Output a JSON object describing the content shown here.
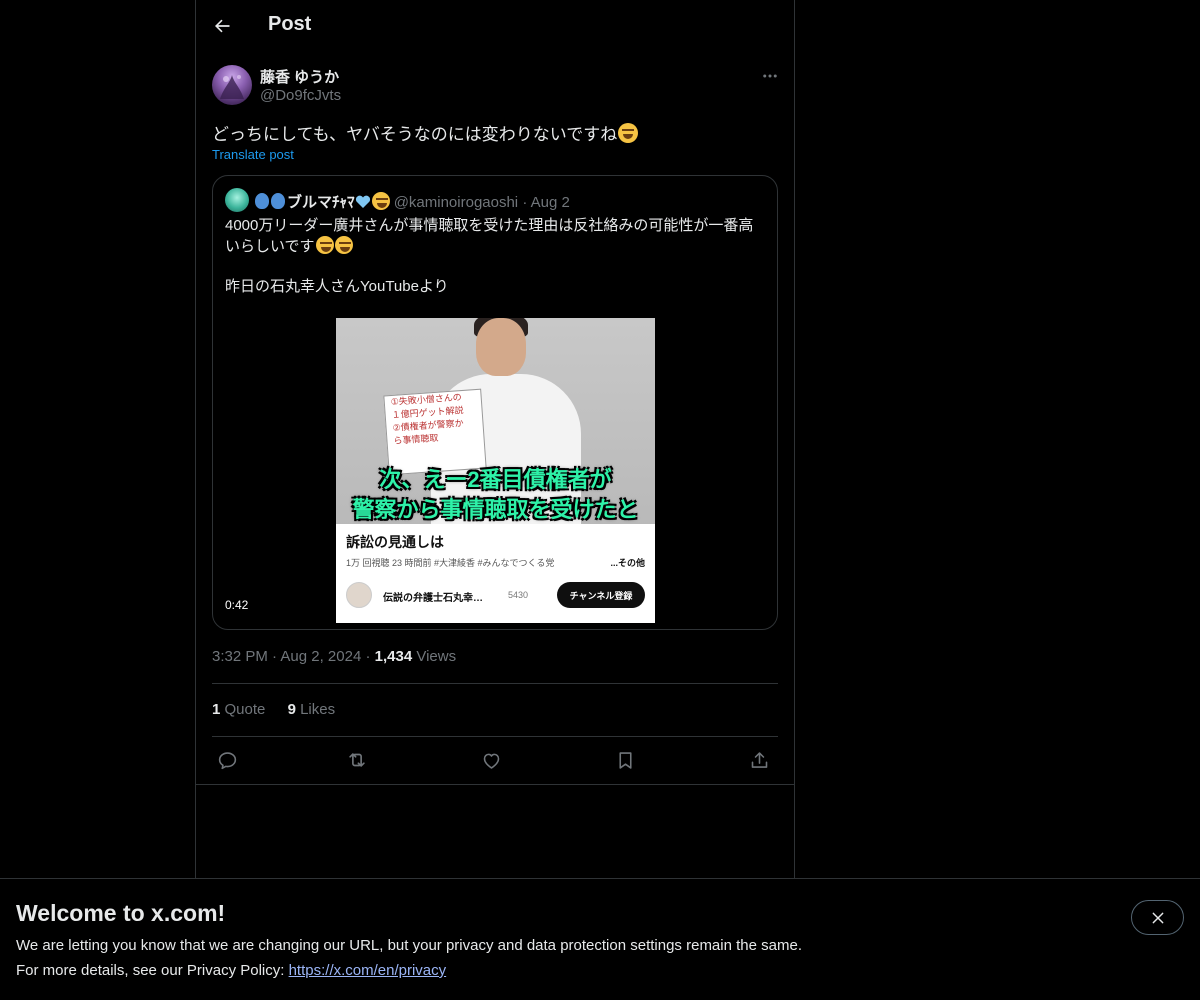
{
  "header": {
    "title": "Post"
  },
  "post": {
    "display_name": "藤香 ゆうか",
    "handle": "@Do9fcJvts",
    "text": "どっちにしても、ヤバそうなのには変わりないですね",
    "translate_label": "Translate post",
    "time": "3:32 PM",
    "date": "Aug 2, 2024",
    "views_count": "1,434",
    "views_label": "Views",
    "quote_count": "1",
    "quote_label": "Quote",
    "likes_count": "9",
    "likes_label": "Likes"
  },
  "quoted": {
    "name": "ブルマﾁｬﾏ",
    "handle": "@kaminoirogaoshi",
    "date": "Aug 2",
    "text_line1": "4000万リーダー廣井さんが事情聴取を受けた理由は反社絡みの可能性が一番高いらしいです",
    "text_line2": "昨日の石丸幸人さんYouTubeより",
    "video": {
      "duration": "0:42",
      "board_lines": [
        "①失敗小僧さんの",
        "１億円ゲット解説",
        "②債権者が警察か",
        "ら事情聴取"
      ],
      "caption_line1": "次、えー2番目債権者が",
      "caption_line2": "警察から事情聴取を受けたと",
      "yt_title": "訴訟の見通しは",
      "yt_meta": "1万 回視聴  23 時間前  #大津綾香  #みんなでつくる党",
      "yt_more": "...その他",
      "yt_channel": "伝説の弁護士石丸幸…",
      "yt_subs": "5430",
      "yt_subscribe": "チャンネル登録"
    }
  },
  "banner": {
    "title": "Welcome to x.com!",
    "line1": "We are letting you know that we are changing our URL, but your privacy and data protection settings remain the same.",
    "line2_prefix": "For more details, see our Privacy Policy: ",
    "link": "https://x.com/en/privacy"
  },
  "colors": {
    "accent": "#1d9bf0",
    "link_banner": "#9bb5f6",
    "muted": "#71767b",
    "border": "#2f3336",
    "caption": "#2ef2a8"
  },
  "icons": [
    "back-arrow-icon",
    "more-icon",
    "reply-icon",
    "repost-icon",
    "like-icon",
    "bookmark-icon",
    "share-icon",
    "close-icon"
  ]
}
